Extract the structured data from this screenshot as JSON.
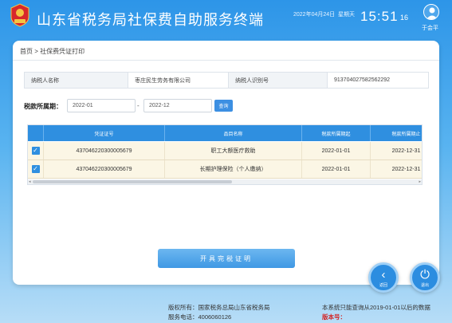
{
  "header": {
    "title": "山东省税务局社保费自助服务终端",
    "date": "2022年04月24日",
    "weekday": "星期天",
    "time": "15:51",
    "seconds": "16",
    "user_name": "于会平",
    "emblem_icon": "tax-emblem",
    "emblem_text": "中国税务"
  },
  "breadcrumb": "首页 > 社保费凭证打印",
  "taxpayer": {
    "name_label": "纳税人名称",
    "name_value": "枣庄民生劳务有限公司",
    "id_label": "纳税人识别号",
    "id_value": "913704027582562292"
  },
  "filter": {
    "period_label": "税款所属期：",
    "from": "2022-01",
    "separator": "-",
    "to": "2022-12",
    "query_label": "查询"
  },
  "table": {
    "headers": [
      "凭证证号",
      "品目名称",
      "税款所属期起",
      "税款所属期止"
    ],
    "rows": [
      {
        "checked": true,
        "voucher_no": "437046220300005679",
        "item": "职工大额医疗救助",
        "start": "2022-01-01",
        "end": "2022-12-31"
      },
      {
        "checked": true,
        "voucher_no": "437046220300005679",
        "item": "长期护理保险（个人缴纳）",
        "start": "2022-01-01",
        "end": "2022-12-31"
      }
    ]
  },
  "actions": {
    "issue_label": "开具完税证明",
    "back_label": "返回",
    "exit_label": "退出"
  },
  "footer": {
    "copyright": "版权所有：国家税务总局山东省税务局",
    "phone": "服务电话：4006060126",
    "notice": "本系统只能查询从2019-01-01以后的数据",
    "version_label": "版本号："
  },
  "colors": {
    "accent": "#2f8fe0",
    "row_bg": "#fbf6e5",
    "version": "#d32222"
  }
}
